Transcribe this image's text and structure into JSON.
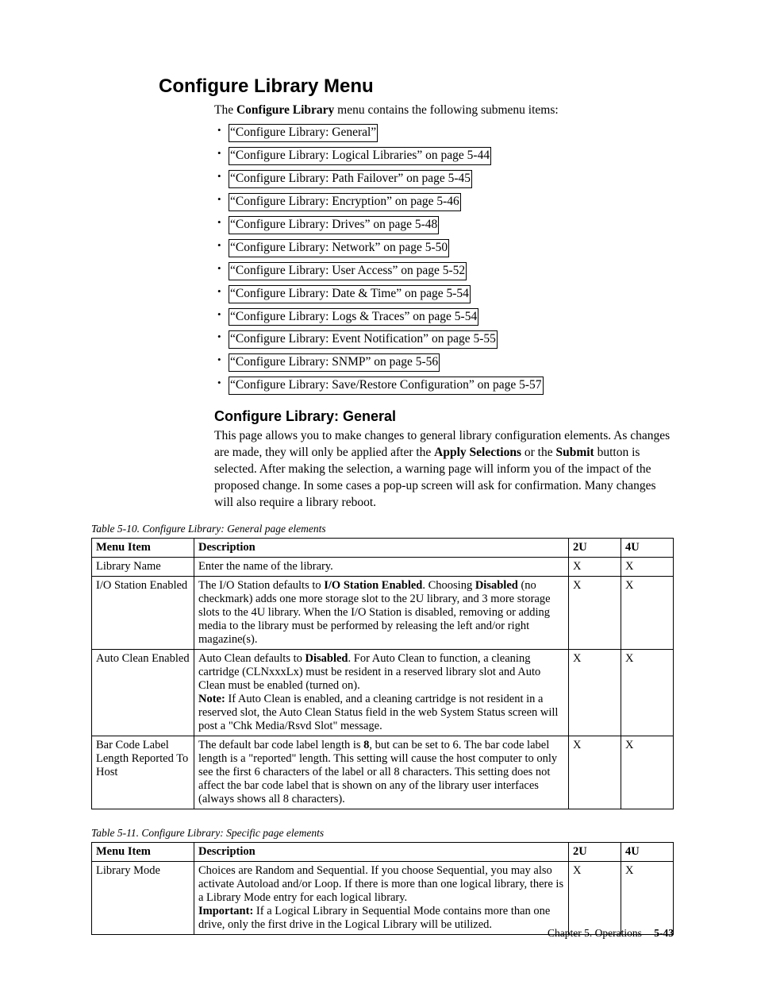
{
  "heading": "Configure Library Menu",
  "intro_pre": "The ",
  "intro_bold": "Configure Library",
  "intro_post": " menu contains the following submenu items:",
  "links": [
    "“Configure Library: General”",
    "“Configure Library: Logical Libraries” on page 5-44",
    "“Configure Library: Path Failover” on page 5-45",
    "“Configure Library: Encryption” on page 5-46",
    "“Configure Library: Drives” on page 5-48",
    "“Configure Library: Network” on page 5-50",
    "“Configure Library: User Access” on page 5-52",
    "“Configure Library: Date & Time” on page 5-54",
    "“Configure Library: Logs & Traces” on page 5-54",
    "“Configure Library: Event Notification” on page 5-55",
    "“Configure Library: SNMP” on page 5-56",
    "“Configure Library: Save/Restore Configuration” on page 5-57"
  ],
  "sub_heading": "Configure Library: General",
  "sub_para_parts": {
    "p1": "This page allows you to make changes to general library configuration elements. As changes are made, they will only be applied after the ",
    "b1": "Apply Selections",
    "p2": " or the ",
    "b2": "Submit",
    "p3": " button is selected. After making the selection, a warning page will inform you of the impact of the proposed change. In some cases a pop-up screen will ask for confirmation. Many changes will also require a library reboot."
  },
  "table1": {
    "caption": "Table 5-10. Configure Library: General page elements",
    "headers": {
      "c1": "Menu Item",
      "c2": "Description",
      "c3": "2U",
      "c4": "4U"
    },
    "rows": [
      {
        "menu": "Library Name",
        "desc_plain": "Enter the name of the library.",
        "u2": "X",
        "u4": "X"
      },
      {
        "menu": "I/O Station Enabled",
        "desc_parts": {
          "t1": "The I/O Station defaults to ",
          "b1": "I/O Station Enabled",
          "t2": ". Choosing ",
          "b2": "Disabled",
          "t3": " (no checkmark) adds one more storage slot to the 2U library, and 3 more storage slots to the 4U library. When the I/O Station is disabled, removing or adding media to the library must be performed by releasing the left and/or right magazine(s)."
        },
        "u2": "X",
        "u4": "X"
      },
      {
        "menu": "Auto Clean Enabled",
        "desc_parts": {
          "t1": "Auto Clean defaults to ",
          "b1": "Disabled",
          "t2": ". For Auto Clean to function, a cleaning cartridge (CLNxxxLx) must be resident in a reserved library slot and Auto Clean must be enabled (turned on).",
          "br": true,
          "b2": "Note:",
          "t3": " If Auto Clean is enabled, and a cleaning cartridge is not resident in a reserved slot, the Auto Clean Status field in the web System Status screen will post a \"Chk Media/Rsvd Slot\" message."
        },
        "u2": "X",
        "u4": "X"
      },
      {
        "menu": "Bar Code Label Length Reported To Host",
        "desc_parts": {
          "t1": "The default bar code label length is ",
          "b1": "8",
          "t2": ", but can be set to 6. The bar code label length is a \"reported\" length. This setting will cause the host computer to only see the first 6 characters of the label or all 8 characters. This setting does not affect the bar code label that is shown on any of the library user interfaces (always shows all 8 characters)."
        },
        "u2": "X",
        "u4": "X"
      }
    ]
  },
  "table2": {
    "caption": "Table 5-11. Configure Library: Specific page elements",
    "headers": {
      "c1": "Menu Item",
      "c2": "Description",
      "c3": "2U",
      "c4": "4U"
    },
    "rows": [
      {
        "menu": "Library Mode",
        "desc_parts": {
          "t1": "Choices are Random and Sequential. If you choose Sequential, you may also activate Autoload and/or Loop. If there is more than one logical library, there is a Library Mode entry for each logical library.",
          "br": true,
          "b1": "Important:",
          "t2": " If a Logical Library in Sequential Mode contains more than one drive, only the first drive in the Logical Library will be utilized."
        },
        "u2": "X",
        "u4": "X"
      }
    ]
  },
  "footer": {
    "chapter": "Chapter 5. Operations",
    "page": "5-43"
  }
}
